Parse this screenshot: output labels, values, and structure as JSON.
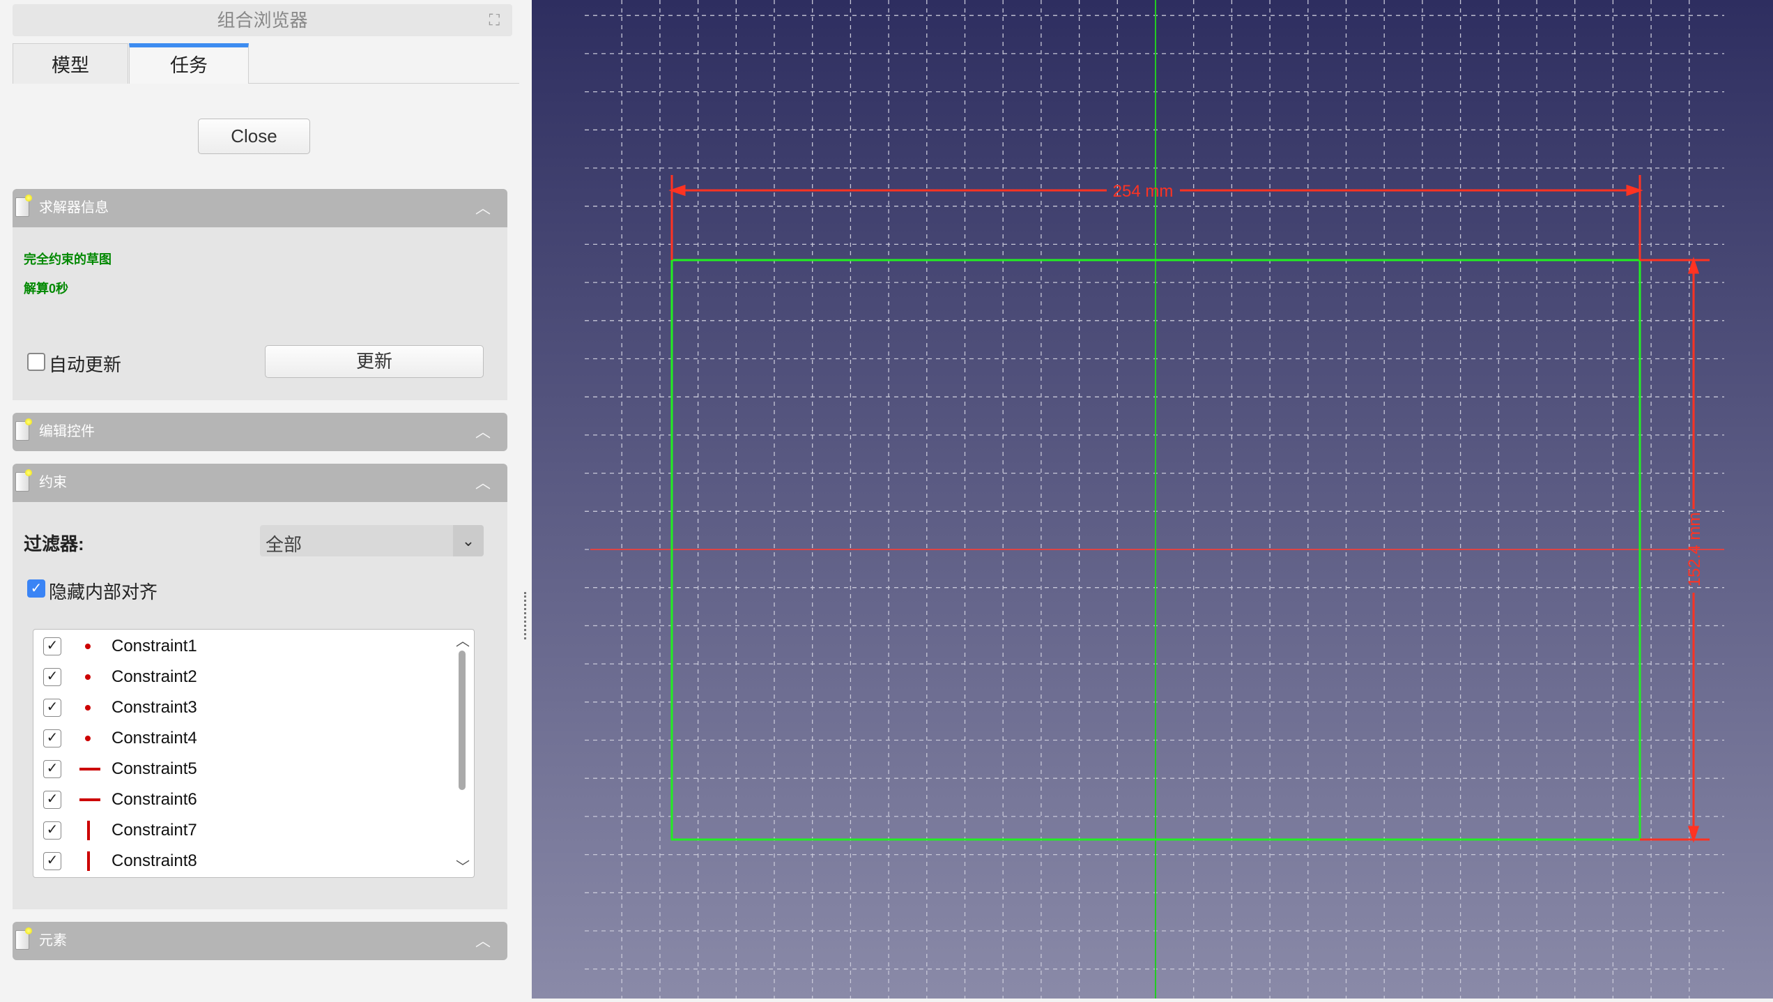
{
  "panel": {
    "title": "组合浏览器",
    "tabs": [
      "模型",
      "任务"
    ],
    "close": "Close"
  },
  "solver": {
    "title": "求解器信息",
    "status": "完全约束的草图",
    "time": "解算0秒",
    "auto_update": "自动更新",
    "update": "更新"
  },
  "edit": {
    "title": "编辑控件"
  },
  "constraints": {
    "title": "约束",
    "filter_label": "过滤器:",
    "filter_value": "全部",
    "hide_internal": "隐藏内部对齐",
    "items": [
      {
        "name": "Constraint1",
        "icon": "point"
      },
      {
        "name": "Constraint2",
        "icon": "point"
      },
      {
        "name": "Constraint3",
        "icon": "point"
      },
      {
        "name": "Constraint4",
        "icon": "point"
      },
      {
        "name": "Constraint5",
        "icon": "horizontal"
      },
      {
        "name": "Constraint6",
        "icon": "horizontal"
      },
      {
        "name": "Constraint7",
        "icon": "vertical"
      },
      {
        "name": "Constraint8",
        "icon": "vertical"
      }
    ]
  },
  "elements": {
    "title": "元素"
  },
  "sketch": {
    "width_dim": "254 mm",
    "height_dim": "152.4 mm",
    "colors": {
      "geometry": "#22ee22",
      "dimension": "#ff3322",
      "axis_y": "#22cc22",
      "axis_x": "#dd4444"
    }
  }
}
